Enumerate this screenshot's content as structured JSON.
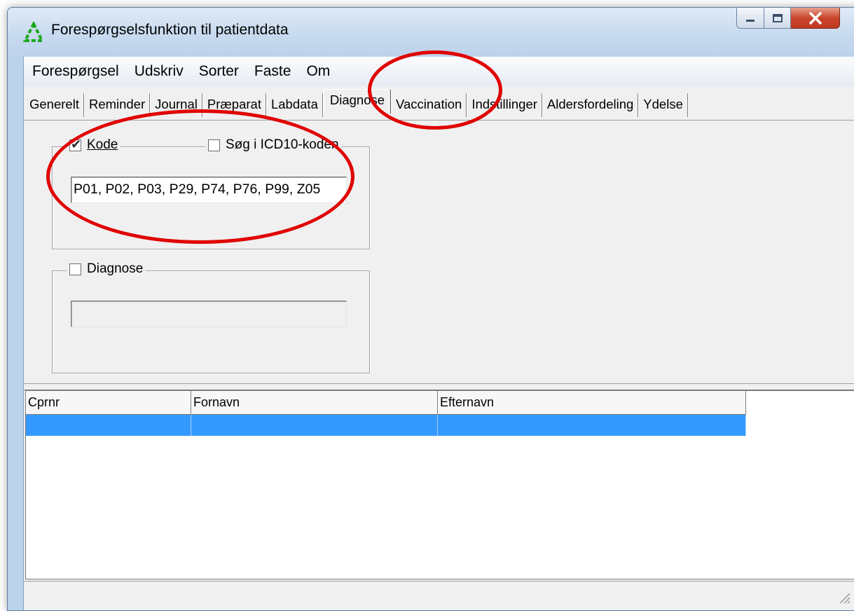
{
  "window": {
    "title": "Forespørgselsfunktion til patientdata",
    "app_icon": "triangle-logo-icon",
    "controls": [
      "minimize-icon",
      "maximize-icon",
      "close-icon"
    ]
  },
  "menu": [
    "Forespørgsel",
    "Udskriv",
    "Sorter",
    "Faste",
    "Om"
  ],
  "tabs": [
    "Generelt",
    "Reminder",
    "Journal",
    "Præparat",
    "Labdata",
    "Diagnose",
    "Vaccination",
    "Indstillinger",
    "Aldersfordeling",
    "Ydelse"
  ],
  "active_tab": "Diagnose",
  "kode_group": {
    "label": "Kode",
    "checked": true,
    "icd10_label": "Søg i ICD10-koden",
    "icd10_checked": false,
    "value": "P01, P02, P03, P29, P74, P76, P99, Z05"
  },
  "diagnose_group": {
    "label": "Diagnose",
    "checked": false,
    "value": ""
  },
  "grid": {
    "columns": [
      "Cprnr",
      "Fornavn",
      "Efternavn"
    ],
    "selected_row_color": "#3399ff"
  },
  "colors": {
    "annotation": "#e00000",
    "selection": "#3399ff"
  }
}
